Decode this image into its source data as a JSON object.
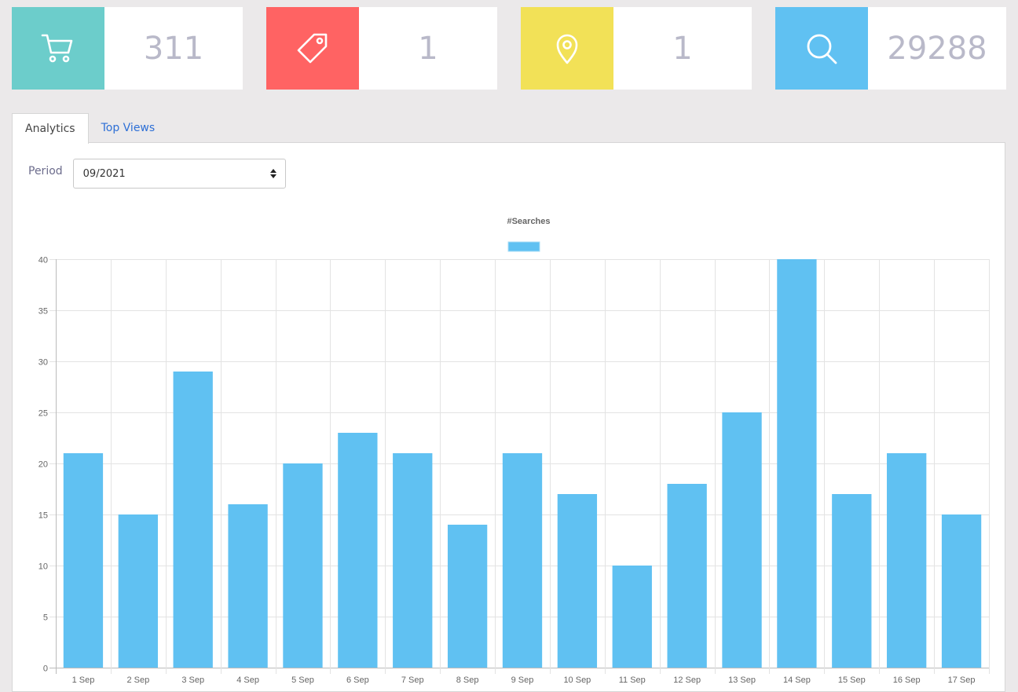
{
  "stats": [
    {
      "icon": "cart-icon",
      "color": "#6ccdcb",
      "value": "311"
    },
    {
      "icon": "tag-icon",
      "color": "#ff6363",
      "value": "1"
    },
    {
      "icon": "location-pin-icon",
      "color": "#f2e157",
      "value": "1"
    },
    {
      "icon": "search-icon",
      "color": "#60c1f2",
      "value": "29288"
    }
  ],
  "tabs": {
    "analytics": "Analytics",
    "top_views": "Top Views"
  },
  "period": {
    "label": "Period",
    "value": "09/2021"
  },
  "chart_data": {
    "type": "bar",
    "title": "#Searches",
    "categories": [
      "1 Sep",
      "2 Sep",
      "3 Sep",
      "4 Sep",
      "5 Sep",
      "6 Sep",
      "7 Sep",
      "8 Sep",
      "9 Sep",
      "10 Sep",
      "11 Sep",
      "12 Sep",
      "13 Sep",
      "14 Sep",
      "15 Sep",
      "16 Sep",
      "17 Sep"
    ],
    "values": [
      21,
      15,
      29,
      16,
      20,
      23,
      21,
      14,
      21,
      17,
      10,
      18,
      25,
      40,
      17,
      21,
      15
    ],
    "ylim": [
      0,
      40
    ],
    "yticks": [
      0,
      5,
      10,
      15,
      20,
      25,
      30,
      35,
      40
    ],
    "legend": "top-center",
    "grid": true,
    "color": "#60c1f2"
  }
}
